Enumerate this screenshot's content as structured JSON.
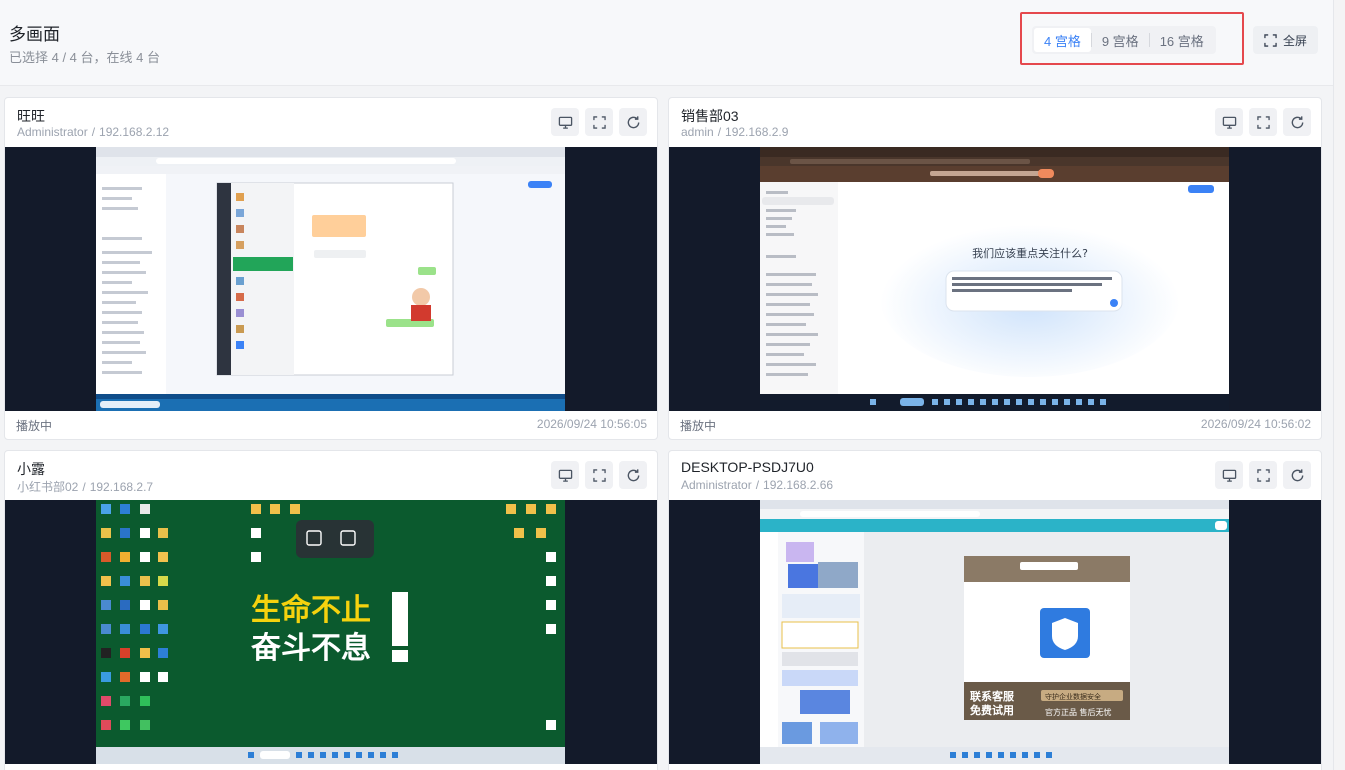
{
  "page": {
    "title": "多画面",
    "subtitle": "已选择 4 / 4 台，在线 4 台"
  },
  "layout_switch": {
    "options": [
      {
        "label": "4 宫格",
        "selected": true
      },
      {
        "label": "9 宫格",
        "selected": false
      },
      {
        "label": "16 宫格",
        "selected": false
      }
    ]
  },
  "fullscreen": {
    "label": "全屏",
    "icon": "fullscreen-icon"
  },
  "cards": [
    {
      "name": "旺旺",
      "user": "Administrator",
      "ip": "192.168.2.12",
      "status": "播放中",
      "time": "2026/09/24 10:56:05",
      "tools": [
        "monitor-icon",
        "fullscreen-icon",
        "refresh-icon"
      ]
    },
    {
      "name": "销售部03",
      "user": "admin",
      "ip": "192.168.2.9",
      "status": "播放中",
      "time": "2026/09/24 10:56:02",
      "tools": [
        "monitor-icon",
        "fullscreen-icon",
        "refresh-icon"
      ]
    },
    {
      "name": "小露",
      "user": "小红书部02",
      "ip": "192.168.2.7",
      "status": "",
      "time": "",
      "tools": [
        "monitor-icon",
        "fullscreen-icon",
        "refresh-icon"
      ]
    },
    {
      "name": "DESKTOP-PSDJ7U0",
      "user": "Administrator",
      "ip": "192.168.2.66",
      "status": "",
      "time": "",
      "tools": [
        "monitor-icon",
        "fullscreen-icon",
        "refresh-icon"
      ]
    }
  ],
  "screens": {
    "screen2_heading": "我们应该重点关注什么?",
    "screen3_wallpaper_line1": "生命不止",
    "screen3_wallpaper_line2": "奋斗不息",
    "screen4_poster_line1": "联系客服",
    "screen4_poster_line2": "免费试用",
    "screen4_poster_tag": "守护企业数据安全",
    "screen4_poster_footer": "官方正品 售后无忧"
  },
  "colors": {
    "accent": "#3b82f6",
    "highlight_border": "#e5484d",
    "screen_bg": "#131a2a",
    "desktop_green": "#0b5a2e"
  }
}
